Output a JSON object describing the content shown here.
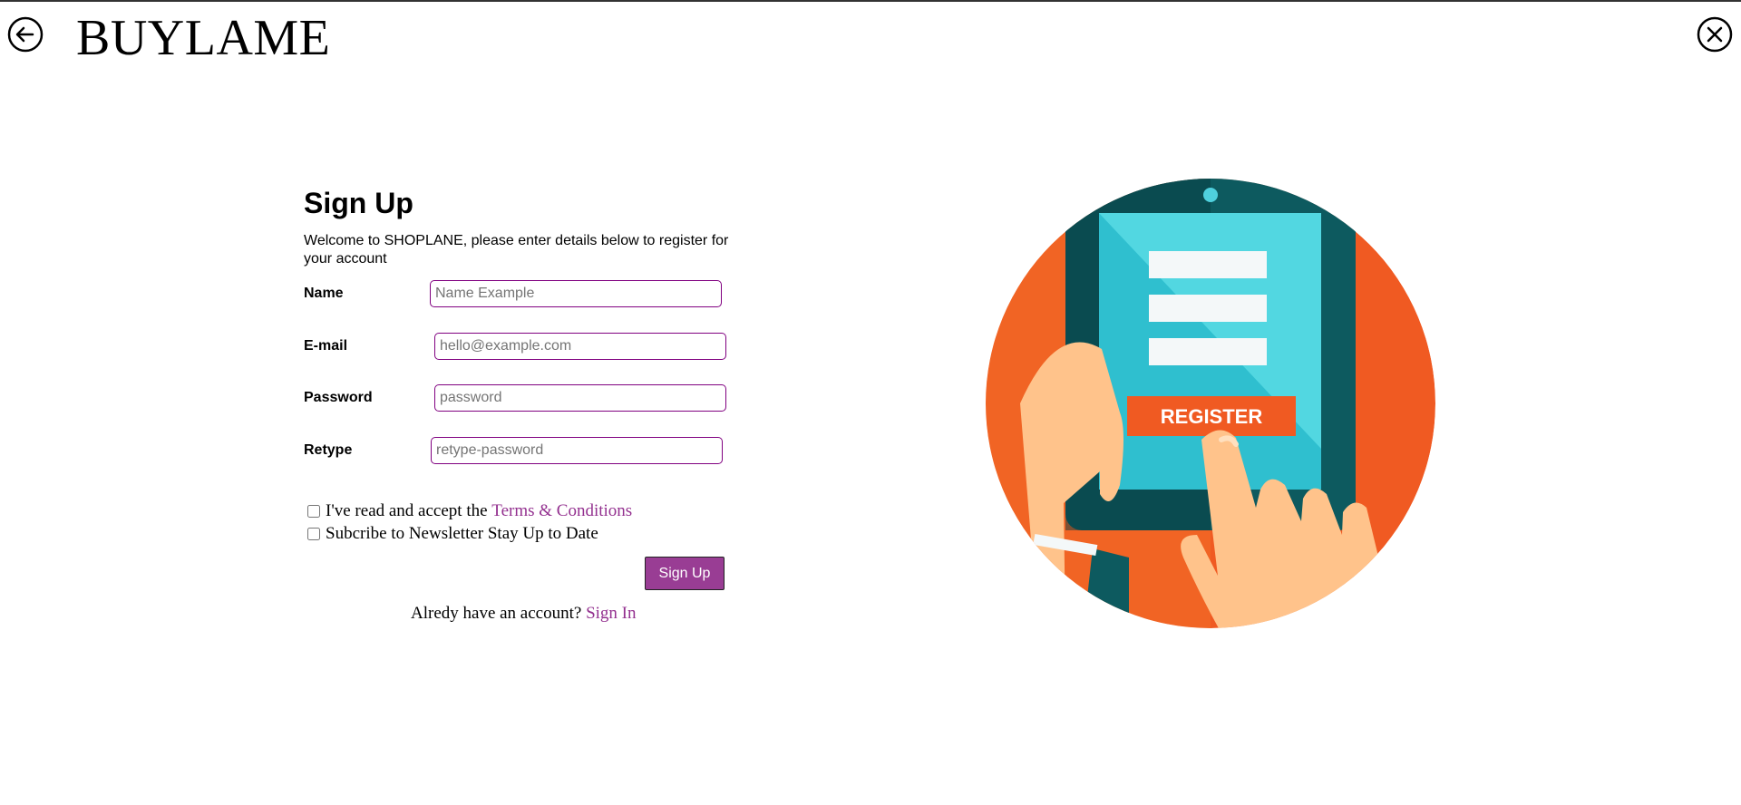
{
  "header": {
    "brand": "BUYLAME",
    "back_icon": "arrow-left-circle-icon",
    "close_icon": "close-circle-icon"
  },
  "form": {
    "title": "Sign Up",
    "welcome": "Welcome to SHOPLANE, please enter details below to register for your account",
    "fields": [
      {
        "label": "Name",
        "placeholder": "Name Example",
        "value": ""
      },
      {
        "label": "E-mail",
        "placeholder": "hello@example.com",
        "value": ""
      },
      {
        "label": "Password",
        "placeholder": "password",
        "value": ""
      },
      {
        "label": "Retype",
        "placeholder": "retype-password",
        "value": ""
      }
    ],
    "terms_prefix": "I've read and accept the",
    "terms_link": "Terms & Conditions",
    "terms_checked": false,
    "newsletter": "Subcribe to Newsletter Stay Up to Date",
    "newsletter_checked": false,
    "submit_label": "Sign Up",
    "signin_prompt": "Alredy have an account?",
    "signin_link": "Sign In"
  },
  "illustration": {
    "button_text": "REGISTER",
    "icon": "tablet-register-illustration"
  },
  "colors": {
    "accent": "#993d94",
    "input_border": "#800080",
    "link": "#93308f",
    "orange": "#f05a22",
    "teal_dark": "#0d5a5f",
    "screen": "#2fbfcf"
  }
}
